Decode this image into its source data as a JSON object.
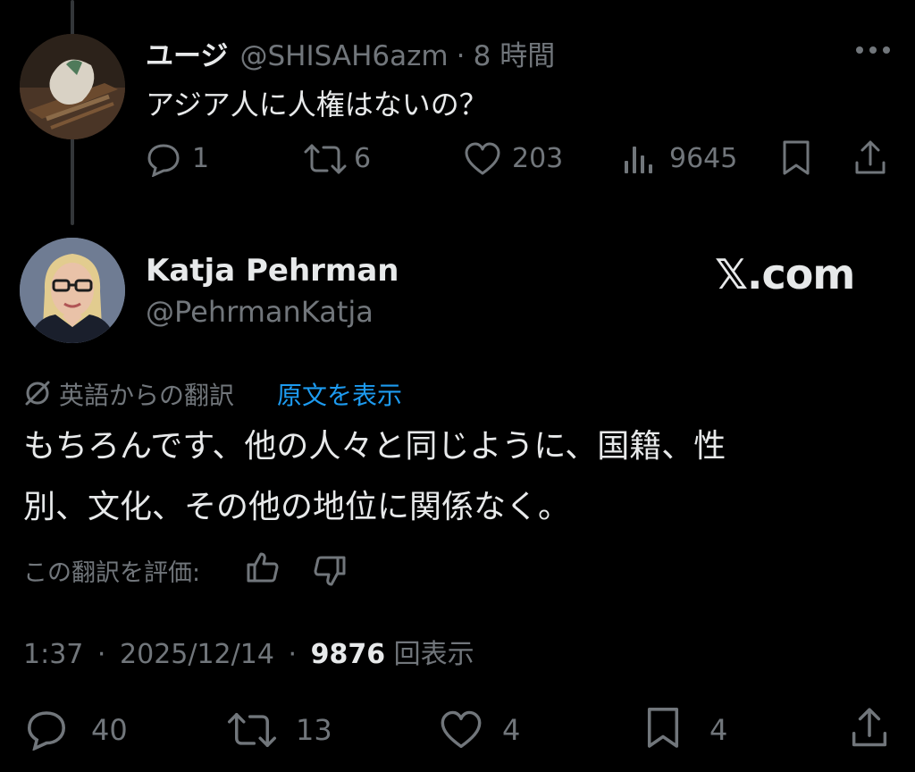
{
  "parent_tweet": {
    "display_name": "ユージ",
    "handle": "@SHISAH6azm",
    "separator": "·",
    "time": "8 時間",
    "text": "アジア人に人権はないの？",
    "stats": {
      "replies": "1",
      "reposts": "6",
      "likes": "203",
      "views": "9645"
    }
  },
  "main_tweet": {
    "display_name": "Katja Pehrman",
    "handle": "@PehrmanKatja",
    "watermark": "𝕏.com",
    "translation_label": "英語からの翻訳",
    "show_original": "原文を表示",
    "text_line1": "もちろんです、他の人々と同じように、国籍、性",
    "text_line2": "別、文化、その他の地位に関係なく。",
    "rate_label": "この翻訳を評価:",
    "time": "1:37",
    "dot1": "·",
    "date": "2025/12/14",
    "dot2": "·",
    "views_count": "9876",
    "views_label": "回表示",
    "stats": {
      "replies": "40",
      "reposts": "13",
      "likes": "4",
      "bookmarks": "4"
    }
  },
  "icons": {
    "reply": "reply-icon",
    "repost": "repost-icon",
    "like": "heart-icon",
    "views": "views-chart-icon",
    "bookmark": "bookmark-icon",
    "share": "share-icon",
    "more": "more-icon",
    "translate": "translate-icon",
    "thumbs_up": "thumbs-up-icon",
    "thumbs_down": "thumbs-down-icon"
  },
  "colors": {
    "background": "#000000",
    "text": "#e7e9ea",
    "muted": "#71767b",
    "link": "#1d9bf0"
  }
}
